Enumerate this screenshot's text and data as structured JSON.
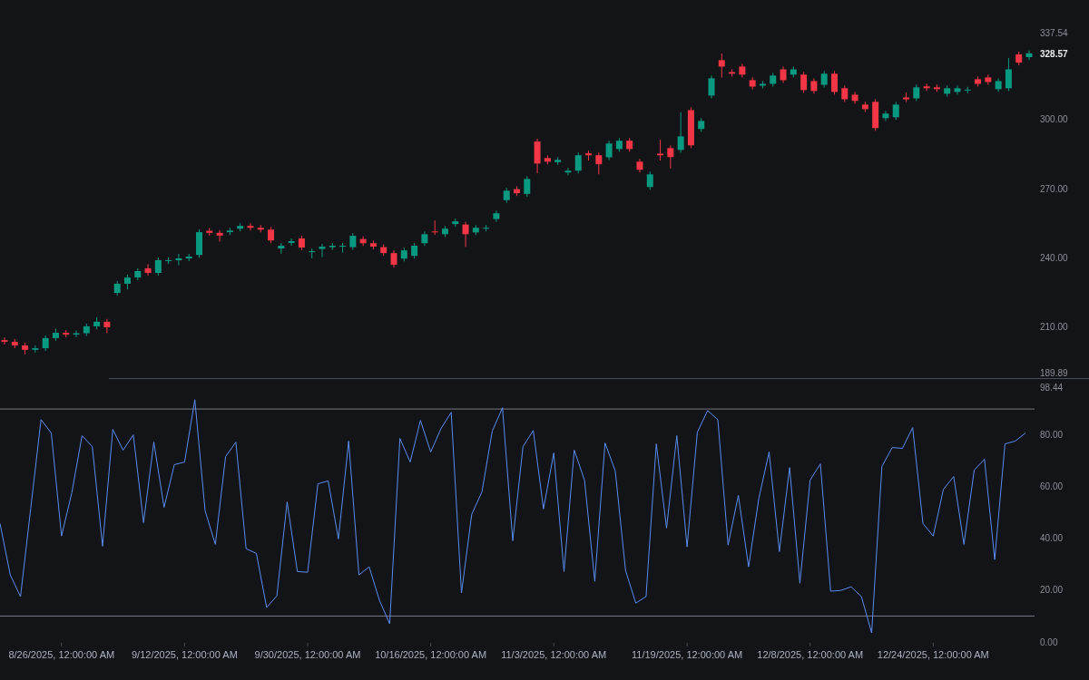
{
  "price_chart": {
    "chart_data": {
      "type": "candlestick",
      "ylim": [
        189.89,
        337.54
      ],
      "yticks": [
        {
          "value": 337.54,
          "label": "337.54"
        },
        {
          "value": 300,
          "label": "300.00"
        },
        {
          "value": 270,
          "label": "270.00"
        },
        {
          "value": 240,
          "label": "240.00"
        },
        {
          "value": 210,
          "label": "210.00"
        },
        {
          "value": 189.89,
          "label": "189.89"
        }
      ],
      "categories": [
        null,
        null,
        null,
        null,
        null,
        null,
        null,
        null,
        null,
        null,
        null,
        null,
        null,
        null,
        null,
        null,
        null,
        null,
        null,
        null,
        null,
        null,
        null,
        null,
        null,
        null,
        null,
        null,
        null,
        null,
        null,
        null,
        null,
        null,
        null,
        null,
        null,
        null,
        null,
        null,
        null,
        null,
        null,
        null,
        null,
        null,
        null,
        null,
        null,
        null,
        null,
        null,
        null,
        null,
        null,
        null,
        null,
        null,
        null,
        null,
        null,
        null,
        null,
        null,
        null,
        null,
        null,
        null,
        null,
        null,
        null,
        null,
        null,
        null,
        null,
        null,
        null,
        null,
        null,
        null,
        null,
        null,
        null,
        null,
        null,
        null,
        null,
        null,
        null,
        null,
        null,
        null,
        null,
        null,
        null,
        null,
        null,
        null,
        null,
        null,
        null
      ],
      "ohlc": [
        [
          204.0,
          205.2,
          202.1,
          203.3
        ],
        [
          203.3,
          204.5,
          200.5,
          201.7
        ],
        [
          201.7,
          202.9,
          197.8,
          199.8
        ],
        [
          199.8,
          201.7,
          198.6,
          200.5
        ],
        [
          200.5,
          206.1,
          199.3,
          204.9
        ],
        [
          204.9,
          209.0,
          203.7,
          207.2
        ],
        [
          207.2,
          208.4,
          205.2,
          206.4
        ],
        [
          206.4,
          208.2,
          205.2,
          207.0
        ],
        [
          207.0,
          211.2,
          205.8,
          210.0
        ],
        [
          210.0,
          214.0,
          208.8,
          212.0
        ],
        [
          212.0,
          213.2,
          207.0,
          209.6
        ],
        [
          224.5,
          229.7,
          223.3,
          228.5
        ],
        [
          228.5,
          232.4,
          226.0,
          231.2
        ],
        [
          231.2,
          235.2,
          230.0,
          234.0
        ],
        [
          235.2,
          237.0,
          232.0,
          233.2
        ],
        [
          233.2,
          239.9,
          232.0,
          238.7
        ],
        [
          238.3,
          240.0,
          237.1,
          238.7
        ],
        [
          238.7,
          241.5,
          236.5,
          239.5
        ],
        [
          239.5,
          241.5,
          238.3,
          240.3
        ],
        [
          241.0,
          252.1,
          239.8,
          250.9
        ],
        [
          251.5,
          252.7,
          249.4,
          250.6
        ],
        [
          250.6,
          251.8,
          246.8,
          249.4
        ],
        [
          250.9,
          252.8,
          249.7,
          251.6
        ],
        [
          252.4,
          254.8,
          251.2,
          253.6
        ],
        [
          253.6,
          254.8,
          251.6,
          252.8
        ],
        [
          252.8,
          254.0,
          250.8,
          252.0
        ],
        [
          252.0,
          253.2,
          246.1,
          247.3
        ],
        [
          243.8,
          246.2,
          241.5,
          245.0
        ],
        [
          246.2,
          248.2,
          245.0,
          247.0
        ],
        [
          248.2,
          249.4,
          243.0,
          244.2
        ],
        [
          242.2,
          243.8,
          239.5,
          242.6
        ],
        [
          243.6,
          245.8,
          240.0,
          244.6
        ],
        [
          244.4,
          246.2,
          243.2,
          245.0
        ],
        [
          244.6,
          246.2,
          242.0,
          245.0
        ],
        [
          244.4,
          250.5,
          243.2,
          249.3
        ],
        [
          247.9,
          249.1,
          244.9,
          246.1
        ],
        [
          246.1,
          247.3,
          243.4,
          244.6
        ],
        [
          244.4,
          245.6,
          240.6,
          241.8
        ],
        [
          241.8,
          243.0,
          235.5,
          236.7
        ],
        [
          239.4,
          244.2,
          238.2,
          243.0
        ],
        [
          240.6,
          246.2,
          239.4,
          245.0
        ],
        [
          246.1,
          251.2,
          244.9,
          250.0
        ],
        [
          251.2,
          256.0,
          249.7,
          250.9
        ],
        [
          250.0,
          253.6,
          248.8,
          252.4
        ],
        [
          254.4,
          256.8,
          253.2,
          255.6
        ],
        [
          254.2,
          255.4,
          244.5,
          250.0
        ],
        [
          250.8,
          254.0,
          249.6,
          252.8
        ],
        [
          252.4,
          254.0,
          251.2,
          252.8
        ],
        [
          256.6,
          260.3,
          255.4,
          259.1
        ],
        [
          264.8,
          270.1,
          263.6,
          268.9
        ],
        [
          269.6,
          270.8,
          266.6,
          267.8
        ],
        [
          267.5,
          275.2,
          266.3,
          274.0
        ],
        [
          290.3,
          291.5,
          276.5,
          280.7
        ],
        [
          283.1,
          284.3,
          280.3,
          281.5
        ],
        [
          281.3,
          283.5,
          280.1,
          282.3
        ],
        [
          276.8,
          278.8,
          275.6,
          277.6
        ],
        [
          277.6,
          285.5,
          276.4,
          284.3
        ],
        [
          285.1,
          286.3,
          282.0,
          284.3
        ],
        [
          284.3,
          285.5,
          276.0,
          280.4
        ],
        [
          283.4,
          290.6,
          282.2,
          289.4
        ],
        [
          287.0,
          291.8,
          285.8,
          290.6
        ],
        [
          290.6,
          291.8,
          285.8,
          287.0
        ],
        [
          281.5,
          282.7,
          276.8,
          278.0
        ],
        [
          270.5,
          277.2,
          269.3,
          276.0
        ],
        [
          285.0,
          291.0,
          282.0,
          284.3
        ],
        [
          287.4,
          288.6,
          278.5,
          283.5
        ],
        [
          286.6,
          303.0,
          285.4,
          292.5
        ],
        [
          303.9,
          305.1,
          287.4,
          288.6
        ],
        [
          295.7,
          300.4,
          294.5,
          299.2
        ],
        [
          310.2,
          318.9,
          309.0,
          317.7
        ],
        [
          325.6,
          328.5,
          318.0,
          322.8
        ],
        [
          320.4,
          321.6,
          318.5,
          319.7
        ],
        [
          322.8,
          324.0,
          318.1,
          319.3
        ],
        [
          316.9,
          318.1,
          312.9,
          314.1
        ],
        [
          314.5,
          316.5,
          313.3,
          315.3
        ],
        [
          315.3,
          320.1,
          314.1,
          318.9
        ],
        [
          321.6,
          322.8,
          315.7,
          316.9
        ],
        [
          319.3,
          322.8,
          318.1,
          321.6
        ],
        [
          319.3,
          320.5,
          311.4,
          312.6
        ],
        [
          316.5,
          317.7,
          311.0,
          312.2
        ],
        [
          314.9,
          320.9,
          313.7,
          319.7
        ],
        [
          319.7,
          320.9,
          310.6,
          311.8
        ],
        [
          313.4,
          314.6,
          307.4,
          308.6
        ],
        [
          310.6,
          311.8,
          306.7,
          307.9
        ],
        [
          306.3,
          307.5,
          303.1,
          304.3
        ],
        [
          307.5,
          308.7,
          294.9,
          296.1
        ],
        [
          300.4,
          303.6,
          299.2,
          302.4
        ],
        [
          300.8,
          307.5,
          299.6,
          306.3
        ],
        [
          309.4,
          311.5,
          307.4,
          308.6
        ],
        [
          309.0,
          315.0,
          307.8,
          313.8
        ],
        [
          314.2,
          315.4,
          312.2,
          313.4
        ],
        [
          313.8,
          315.0,
          311.8,
          313.0
        ],
        [
          311.0,
          314.6,
          309.8,
          313.4
        ],
        [
          311.8,
          314.6,
          310.6,
          313.4
        ],
        [
          312.4,
          314.0,
          311.2,
          312.8
        ],
        [
          317.3,
          318.5,
          314.1,
          315.3
        ],
        [
          318.1,
          319.3,
          314.9,
          316.1
        ],
        [
          313.0,
          317.7,
          311.8,
          316.5
        ],
        [
          313.4,
          326.5,
          312.2,
          321.6
        ],
        [
          328.1,
          329.3,
          323.3,
          324.5
        ],
        [
          326.9,
          329.8,
          325.7,
          328.57
        ]
      ],
      "annotations": [
        "328.57"
      ]
    }
  },
  "oscillator_chart": {
    "chart_data": {
      "type": "line",
      "ylim": [
        0,
        98.44
      ],
      "yticks": [
        {
          "value": 98.44,
          "label": "98.44"
        },
        {
          "value": 80,
          "label": "80.00"
        },
        {
          "value": 60,
          "label": "60.00"
        },
        {
          "value": 40,
          "label": "40.00"
        },
        {
          "value": 20,
          "label": "20.00"
        },
        {
          "value": 0,
          "label": "0.00"
        }
      ],
      "categories": [
        null,
        null,
        null,
        null,
        null,
        null,
        "8/26/2025, 12:00:00 AM",
        null,
        null,
        null,
        null,
        null,
        null,
        null,
        null,
        null,
        null,
        null,
        "9/12/2025, 12:00:00 AM",
        null,
        null,
        null,
        null,
        null,
        null,
        null,
        null,
        null,
        null,
        null,
        "9/30/2025, 12:00:00 AM",
        null,
        null,
        null,
        null,
        null,
        null,
        null,
        null,
        null,
        null,
        null,
        "10/16/2025, 12:00:00 AM",
        null,
        null,
        null,
        null,
        null,
        null,
        null,
        null,
        null,
        null,
        null,
        "11/3/2025, 12:00:00 AM",
        null,
        null,
        null,
        null,
        null,
        null,
        null,
        null,
        null,
        null,
        null,
        null,
        "11/19/2025, 12:00:00 AM",
        null,
        null,
        null,
        null,
        null,
        null,
        null,
        null,
        null,
        null,
        null,
        "12/8/2025, 12:00:00 AM",
        null,
        null,
        null,
        null,
        null,
        null,
        null,
        null,
        null,
        null,
        null,
        "12/24/2025, 12:00:00 AM",
        null,
        null,
        null,
        null,
        null,
        null,
        null,
        null,
        null
      ],
      "series": [
        {
          "color": "#5b8def",
          "values": [
            45.8,
            25.9,
            17.5,
            51.7,
            85.9,
            80.7,
            40.9,
            57.6,
            79.7,
            75.5,
            37.0,
            82.1,
            74.1,
            80.0,
            46.1,
            77.2,
            52.0,
            68.5,
            69.5,
            93.6,
            50.7,
            37.7,
            71.6,
            77.2,
            36.0,
            34.2,
            13.3,
            17.8,
            54.1,
            27.2,
            26.9,
            61.1,
            62.2,
            39.8,
            77.6,
            25.9,
            29.0,
            16.1,
            7.0,
            78.6,
            69.5,
            85.6,
            73.4,
            82.4,
            88.7,
            18.9,
            49.3,
            58.0,
            81.4,
            90.5,
            39.1,
            75.5,
            81.7,
            51.4,
            73.0,
            27.2,
            74.1,
            62.5,
            23.4,
            76.9,
            66.0,
            27.6,
            15.0,
            17.5,
            76.5,
            44.0,
            79.7,
            36.7,
            81.0,
            89.4,
            85.9,
            37.4,
            56.6,
            29.0,
            55.5,
            73.4,
            34.9,
            67.4,
            22.7,
            62.5,
            68.8,
            19.6,
            19.9,
            21.3,
            17.5,
            3.5,
            67.8,
            75.1,
            74.8,
            82.8,
            45.8,
            40.9,
            59.0,
            63.9,
            37.7,
            66.4,
            70.6,
            31.8,
            76.5,
            77.6,
            80.7
          ]
        }
      ],
      "ref_lines": [
        {
          "axis": "y",
          "value": 90
        },
        {
          "axis": "y",
          "value": 10
        }
      ]
    }
  }
}
